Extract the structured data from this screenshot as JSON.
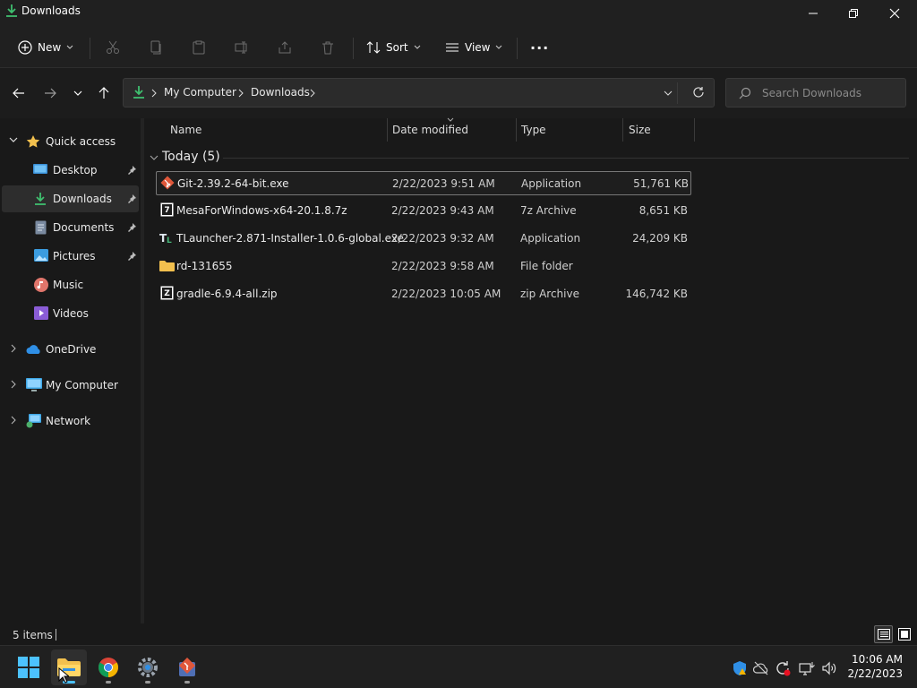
{
  "window": {
    "title": "Downloads"
  },
  "toolbar": {
    "new_label": "New",
    "sort_label": "Sort",
    "view_label": "View",
    "more_label": "···"
  },
  "address": {
    "segments": [
      "My Computer",
      "Downloads"
    ]
  },
  "search": {
    "placeholder": "Search Downloads"
  },
  "sidebar": {
    "quick_access": "Quick access",
    "items": [
      {
        "label": "Desktop",
        "icon": "desktop-icon"
      },
      {
        "label": "Downloads",
        "icon": "download-icon"
      },
      {
        "label": "Documents",
        "icon": "document-icon"
      },
      {
        "label": "Pictures",
        "icon": "pictures-icon"
      },
      {
        "label": "Music",
        "icon": "music-icon"
      },
      {
        "label": "Videos",
        "icon": "videos-icon"
      }
    ],
    "roots": [
      {
        "label": "OneDrive",
        "icon": "cloud-icon"
      },
      {
        "label": "My Computer",
        "icon": "computer-icon"
      },
      {
        "label": "Network",
        "icon": "network-icon"
      }
    ]
  },
  "columns": {
    "name": "Name",
    "date": "Date modified",
    "type": "Type",
    "size": "Size"
  },
  "group": {
    "label": "Today (5)"
  },
  "files": [
    {
      "name": "Git-2.39.2-64-bit.exe",
      "date": "2/22/2023 9:51 AM",
      "type": "Application",
      "size": "51,761 KB",
      "icon": "git-icon"
    },
    {
      "name": "MesaForWindows-x64-20.1.8.7z",
      "date": "2/22/2023 9:43 AM",
      "type": "7z Archive",
      "size": "8,651 KB",
      "icon": "7z-archive-icon"
    },
    {
      "name": "TLauncher-2.871-Installer-1.0.6-global.exe",
      "date": "2/22/2023 9:32 AM",
      "type": "Application",
      "size": "24,209 KB",
      "icon": "tlauncher-icon"
    },
    {
      "name": "rd-131655",
      "date": "2/22/2023 9:58 AM",
      "type": "File folder",
      "size": "",
      "icon": "folder-icon"
    },
    {
      "name": "gradle-6.9.4-all.zip",
      "date": "2/22/2023 10:05 AM",
      "type": "zip Archive",
      "size": "146,742 KB",
      "icon": "zip-archive-icon"
    }
  ],
  "status": {
    "count": "5 items"
  },
  "taskbar": {
    "time": "10:06 AM",
    "date": "2/22/2023"
  },
  "colors": {
    "accent": "#4cc2ff",
    "folder": "#f2c04e",
    "download_green": "#3fbf6f"
  }
}
